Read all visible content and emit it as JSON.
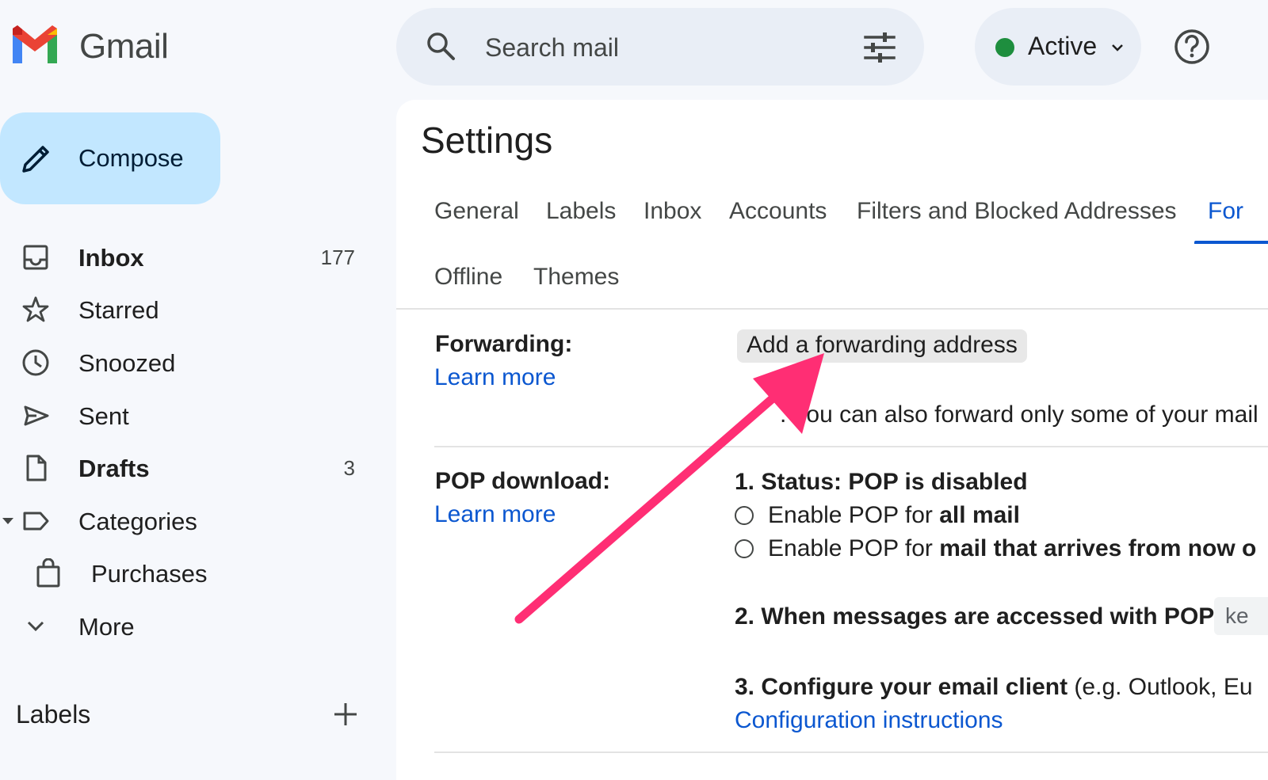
{
  "app": {
    "name": "Gmail",
    "colors": {
      "accent": "#0b57d0",
      "compose_bg": "#c2e7ff",
      "status_green": "#1e8e3e",
      "arrow": "#ff2e74"
    }
  },
  "search": {
    "placeholder": "Search mail"
  },
  "status": {
    "label": "Active"
  },
  "sidebar": {
    "compose_label": "Compose",
    "items": [
      {
        "label": "Inbox",
        "count": "177",
        "icon": "inbox-icon"
      },
      {
        "label": "Starred",
        "count": "",
        "icon": "star-icon"
      },
      {
        "label": "Snoozed",
        "count": "",
        "icon": "clock-icon"
      },
      {
        "label": "Sent",
        "count": "",
        "icon": "send-icon"
      },
      {
        "label": "Drafts",
        "count": "3",
        "icon": "draft-icon"
      },
      {
        "label": "Categories",
        "count": "",
        "icon": "label-icon"
      },
      {
        "label": "Purchases",
        "count": "",
        "icon": "shopping-bag-icon"
      },
      {
        "label": "More",
        "count": "",
        "icon": "chevron-down-icon"
      }
    ],
    "labels_heading": "Labels"
  },
  "settings": {
    "title": "Settings",
    "tabs_row1": [
      "General",
      "Labels",
      "Inbox",
      "Accounts",
      "Filters and Blocked Addresses",
      "For"
    ],
    "tabs_row2": [
      "Offline",
      "Themes"
    ],
    "forwarding": {
      "label": "Forwarding:",
      "learn_more": "Learn more",
      "button": "Add a forwarding address",
      "tip": ". You can also forward only some of your mail"
    },
    "pop": {
      "label": "POP download:",
      "learn_more": "Learn more",
      "status": "1. Status: POP is disabled",
      "opt1_prefix": "Enable POP for ",
      "opt1_bold": "all mail",
      "opt2_prefix": "Enable POP for ",
      "opt2_bold": "mail that arrives from now o",
      "step2": "2. When messages are accessed with POP",
      "step2_value": "ke",
      "step3_bold": "3. Configure your email client",
      "step3_rest": " (e.g. Outlook, Eu",
      "config_link": "Configuration instructions"
    }
  }
}
